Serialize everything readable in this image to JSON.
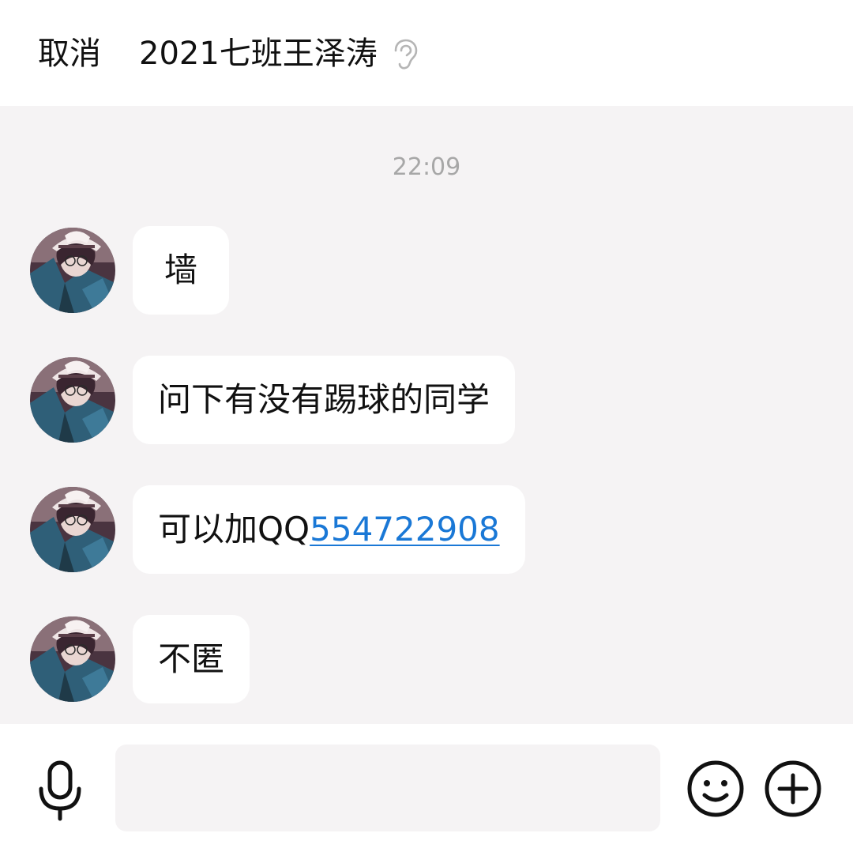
{
  "header": {
    "cancel_label": "取消",
    "title": "2021七班王泽涛",
    "earpiece_icon": "ear-icon"
  },
  "chat": {
    "timestamp": "22:09",
    "messages": [
      {
        "text": "墙"
      },
      {
        "text": "问下有没有踢球的同学"
      },
      {
        "prefix": "可以加QQ",
        "link": "554722908"
      },
      {
        "text": "不匿"
      }
    ]
  },
  "input_bar": {
    "value": "",
    "placeholder": "",
    "left_icon": "microphone-icon",
    "right_icons": [
      "emoji-icon",
      "plus-icon"
    ]
  },
  "colors": {
    "background": "#f5f3f4",
    "surface": "#ffffff",
    "timestamp": "#a7a7a7",
    "link": "#1a78d6",
    "text": "#111111"
  }
}
